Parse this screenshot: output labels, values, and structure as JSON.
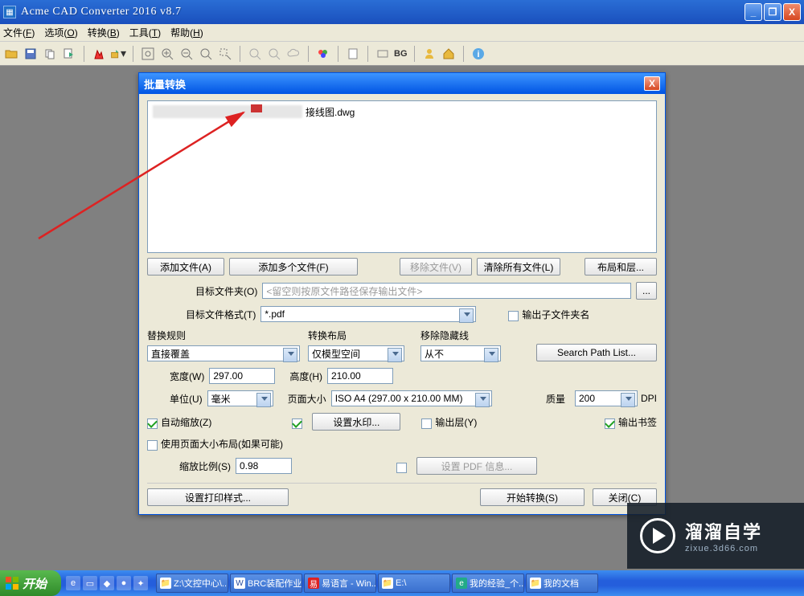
{
  "app": {
    "title": "Acme CAD Converter 2016 v8.7"
  },
  "window_buttons": {
    "min": "_",
    "max": "❐",
    "close": "X"
  },
  "menu": {
    "file": {
      "label": "文件",
      "hot": "F"
    },
    "options": {
      "label": "选项",
      "hot": "O"
    },
    "convert": {
      "label": "转换",
      "hot": "B"
    },
    "tools": {
      "label": "工具",
      "hot": "T"
    },
    "help": {
      "label": "帮助",
      "hot": "H"
    }
  },
  "toolbar": {
    "bg_label": "BG"
  },
  "dialog": {
    "title": "批量转换",
    "close": "X",
    "file_item": "接线图.dwg",
    "buttons": {
      "add_file": "添加文件(A)",
      "add_files": "添加多个文件(F)",
      "remove": "移除文件(V)",
      "clear": "清除所有文件(L)",
      "layout_layers": "布局和层...",
      "browse": "...",
      "search_path": "Search Path List...",
      "watermark": "设置水印...",
      "pdf_info": "设置 PDF 信息...",
      "print_style": "设置打印样式...",
      "start": "开始转换(S)",
      "close_dlg": "关闭(C)"
    },
    "labels": {
      "target_folder": "目标文件夹(O)",
      "target_format": "目标文件格式(T)",
      "output_subfolder": "输出子文件夹名",
      "replace_rule": "替换规则",
      "convert_layout": "转换布局",
      "remove_hidden": "移除隐藏线",
      "width": "宽度(W)",
      "height": "高度(H)",
      "unit": "单位(U)",
      "page_size": "页面大小",
      "quality": "质量",
      "dpi": "DPI",
      "auto_zoom": "自动缩放(Z)",
      "output_layer": "输出层(Y)",
      "output_bookmark": "输出书签",
      "use_page_layout": "使用页面大小布局(如果可能)",
      "zoom_ratio": "缩放比例(S)"
    },
    "values": {
      "target_folder_placeholder": "<留空则按原文件路径保存输出文件>",
      "target_format": "*.pdf",
      "replace_rule": "直接覆盖",
      "convert_layout": "仅模型空间",
      "remove_hidden": "从不",
      "width": "297.00",
      "height": "210.00",
      "unit": "毫米",
      "page_size": "ISO A4 (297.00 x 210.00 MM)",
      "quality": "200",
      "zoom_ratio": "0.98"
    },
    "checks": {
      "output_subfolder": false,
      "auto_zoom": true,
      "watermark_enable": true,
      "output_layer": false,
      "output_bookmark": true,
      "use_page_layout": false,
      "pdf_info_enable": false
    }
  },
  "watermark_logo": {
    "big": "溜溜自学",
    "small": "zixue.3d66.com"
  },
  "taskbar": {
    "start": "开始",
    "tasks": [
      {
        "icon": "📁",
        "label": "Z:\\文控中心\\..."
      },
      {
        "icon": "W",
        "label": "BRC装配作业..."
      },
      {
        "icon": "易",
        "label": "易语言 - Win..."
      },
      {
        "icon": "📁",
        "label": "E:\\"
      },
      {
        "icon": "e",
        "label": "我的经验_个..."
      },
      {
        "icon": "📁",
        "label": "我的文档"
      }
    ]
  }
}
